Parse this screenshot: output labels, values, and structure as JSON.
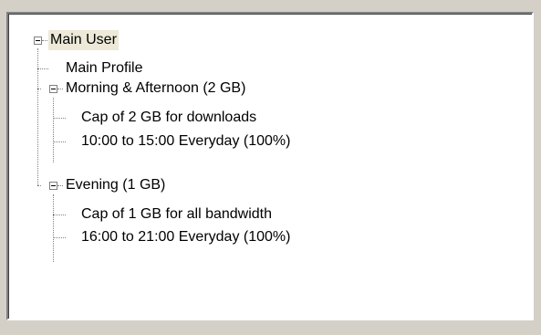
{
  "tree": {
    "root": {
      "label": "Main User",
      "children": {
        "profile": {
          "label": "Main Profile"
        },
        "morning": {
          "label": "Morning & Afternoon (2 GB)",
          "children": [
            {
              "label": "Cap of 2 GB for downloads"
            },
            {
              "label": "10:00 to 15:00 Everyday (100%)"
            }
          ]
        },
        "evening": {
          "label": "Evening (1 GB)",
          "children": [
            {
              "label": "Cap of 1 GB for all bandwidth"
            },
            {
              "label": "16:00 to 21:00 Everyday (100%)"
            }
          ]
        }
      }
    }
  }
}
